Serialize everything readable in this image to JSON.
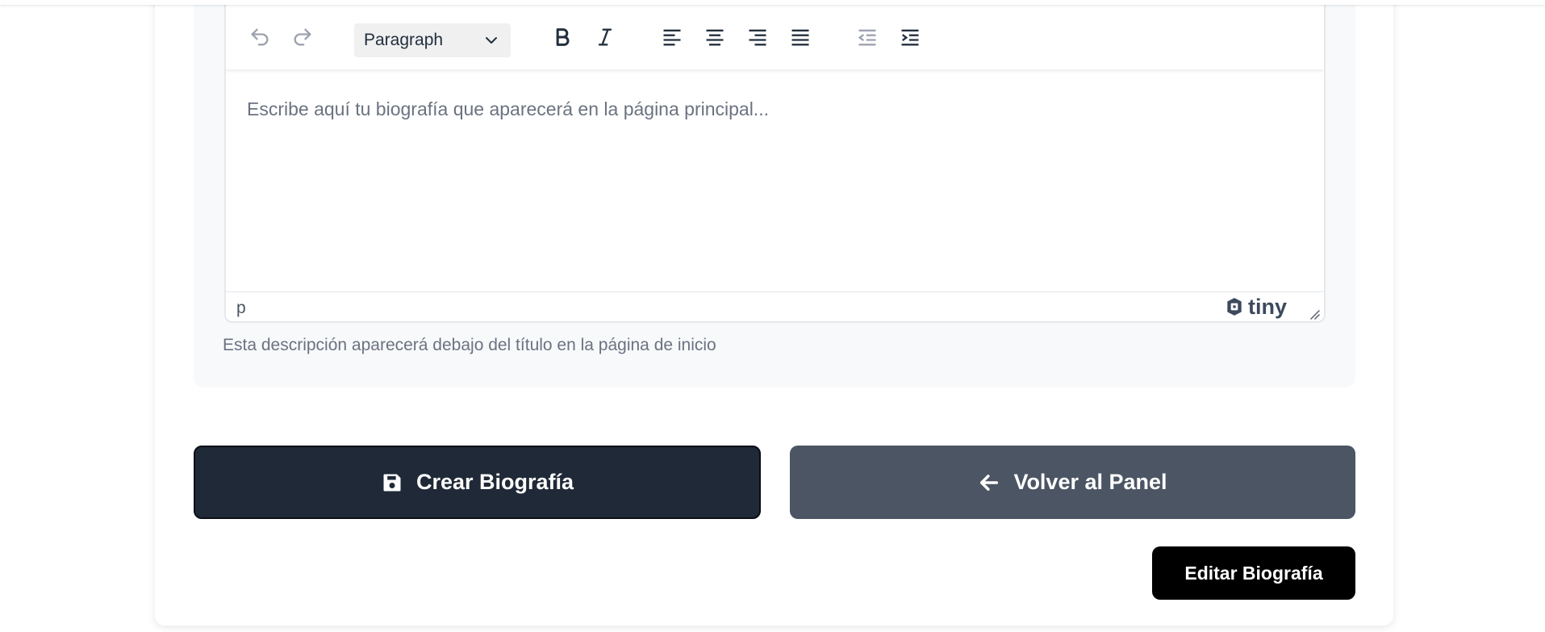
{
  "editor": {
    "toolbar": {
      "undo_icon": "undo-icon",
      "redo_icon": "redo-icon",
      "block_format": "Paragraph",
      "bold_icon": "bold-icon",
      "italic_icon": "italic-icon",
      "align_left_icon": "align-left-icon",
      "align_center_icon": "align-center-icon",
      "align_right_icon": "align-right-icon",
      "align_justify_icon": "align-justify-icon",
      "outdent_icon": "outdent-icon",
      "indent_icon": "indent-icon"
    },
    "placeholder": "Escribe aquí tu biografía que aparecerá en la página principal...",
    "status_path": "p",
    "brand": "tiny"
  },
  "help_text": "Esta descripción aparecerá debajo del título en la página de inicio",
  "actions": {
    "create_label": "Crear Biografía",
    "back_label": "Volver al Panel",
    "edit_label": "Editar Biografía"
  },
  "colors": {
    "create_bg": "#1f2937",
    "back_bg": "#4b5563",
    "edit_bg": "#000000",
    "panel_bg": "#f8f9fb"
  }
}
